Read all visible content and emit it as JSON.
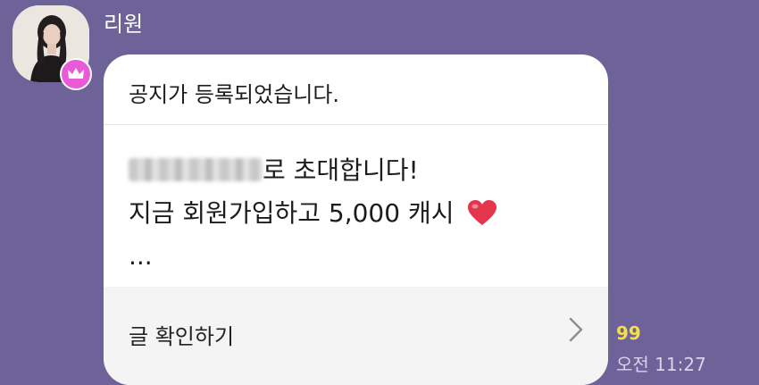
{
  "sender": {
    "name": "리원"
  },
  "message": {
    "notice_title": "공지가 등록되었습니다.",
    "line1_suffix": "로 초대합니다!",
    "line2": "지금 회원가입하고 5,000 캐시 ",
    "line3": "...",
    "footer_label": "글 확인하기"
  },
  "meta": {
    "unread_count": "99",
    "time": "오전 11:27"
  },
  "colors": {
    "background": "#6d6399",
    "bubble": "#ffffff",
    "footer": "#f4f4f4",
    "crown_badge": "#e85ad7",
    "unread": "#f7dd4a",
    "heart": "#e4344e"
  },
  "icons": {
    "badge": "crown-icon",
    "footer": "chevron-right-icon",
    "emoji": "heart-emoji"
  }
}
